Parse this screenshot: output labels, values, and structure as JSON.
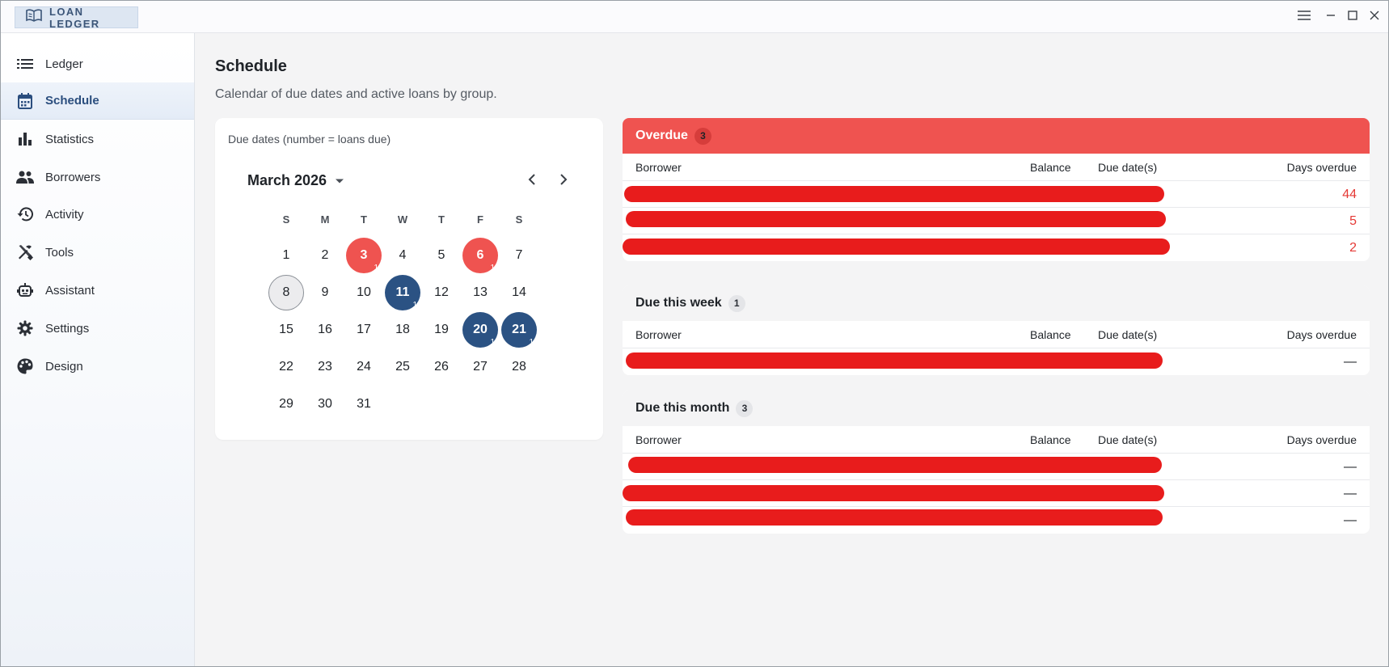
{
  "app": {
    "title": "LOAN LEDGER"
  },
  "sidebar": {
    "items": [
      {
        "label": "Ledger",
        "icon": "list-icon"
      },
      {
        "label": "Schedule",
        "icon": "calendar-icon",
        "active": true
      },
      {
        "label": "Statistics",
        "icon": "bar-chart-icon"
      },
      {
        "label": "Borrowers",
        "icon": "people-icon"
      },
      {
        "label": "Activity",
        "icon": "history-icon"
      },
      {
        "label": "Tools",
        "icon": "tools-icon"
      },
      {
        "label": "Assistant",
        "icon": "robot-icon"
      },
      {
        "label": "Settings",
        "icon": "gear-icon"
      },
      {
        "label": "Design",
        "icon": "palette-icon"
      }
    ]
  },
  "page": {
    "title": "Schedule",
    "subtitle": "Calendar of due dates and active loans by group."
  },
  "calendar": {
    "caption": "Due dates (number = loans due)",
    "month": "March 2026",
    "weekdays": [
      "S",
      "M",
      "T",
      "W",
      "T",
      "F",
      "S"
    ],
    "days": [
      "1",
      "2",
      "3",
      "4",
      "5",
      "6",
      "7",
      "8",
      "9",
      "10",
      "11",
      "12",
      "13",
      "14",
      "15",
      "16",
      "17",
      "18",
      "19",
      "20",
      "21",
      "22",
      "23",
      "24",
      "25",
      "26",
      "27",
      "28",
      "29",
      "30",
      "31"
    ],
    "marked": [
      {
        "day": "3",
        "status": "overdue",
        "count": "1"
      },
      {
        "day": "6",
        "status": "overdue",
        "count": "1"
      },
      {
        "day": "8",
        "status": "today"
      },
      {
        "day": "11",
        "status": "due",
        "count": "1"
      },
      {
        "day": "20",
        "status": "due",
        "count": "1"
      },
      {
        "day": "21",
        "status": "due",
        "count": "1"
      }
    ]
  },
  "columns": {
    "borrower": "Borrower",
    "balance": "Balance",
    "due": "Due date(s)",
    "days": "Days overdue"
  },
  "overdue": {
    "title": "Overdue",
    "count": "3",
    "rows": [
      "44",
      "5",
      "2"
    ]
  },
  "week": {
    "title": "Due this week",
    "count": "1",
    "rows": [
      "—"
    ]
  },
  "month": {
    "title": "Due this month",
    "count": "3",
    "rows": [
      "—",
      "—",
      "—"
    ]
  },
  "colors": {
    "overdue": "#ef5350",
    "due": "#2b5283",
    "accent": "#2b4e7e",
    "redaction": "#e81c1c"
  }
}
